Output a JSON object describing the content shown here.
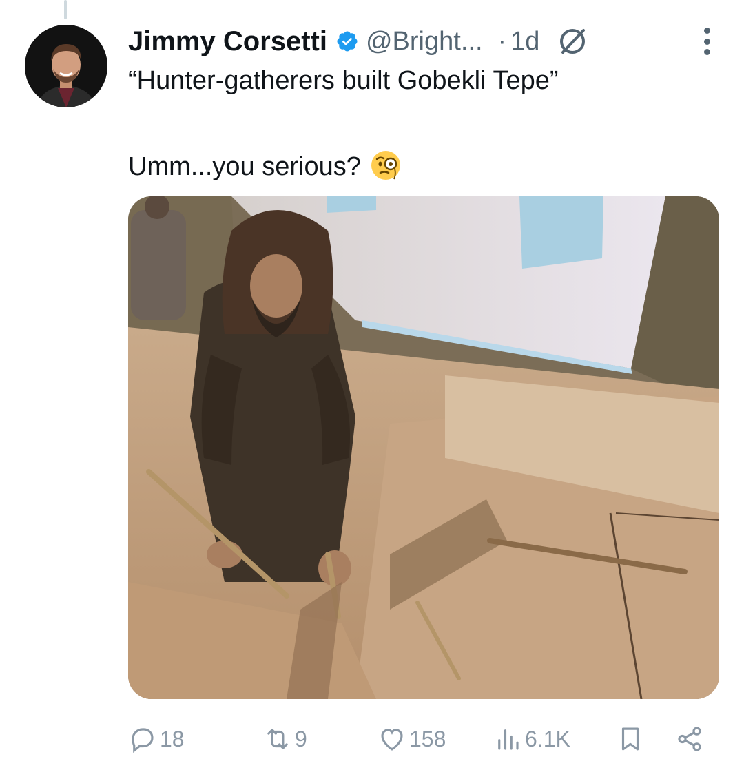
{
  "tweet": {
    "author_name": "Jimmy Corsetti",
    "handle": "@Bright...",
    "separator": "·",
    "time": "1d",
    "text_line1": "“Hunter-gatherers built Gobekli Tepe”",
    "text_line2": "Umm...you serious?",
    "emoji": "face-with-monocle"
  },
  "actions": {
    "replies": "18",
    "reposts": "9",
    "likes": "158",
    "views": "6.1K"
  },
  "colors": {
    "verified_blue": "#1d9bf0",
    "muted_text": "#536471",
    "action_icon": "#8b98a5"
  },
  "icons": [
    "verified-badge-icon",
    "grok-icon",
    "more-icon",
    "reply-icon",
    "repost-icon",
    "like-icon",
    "views-icon",
    "bookmark-icon",
    "share-icon"
  ]
}
